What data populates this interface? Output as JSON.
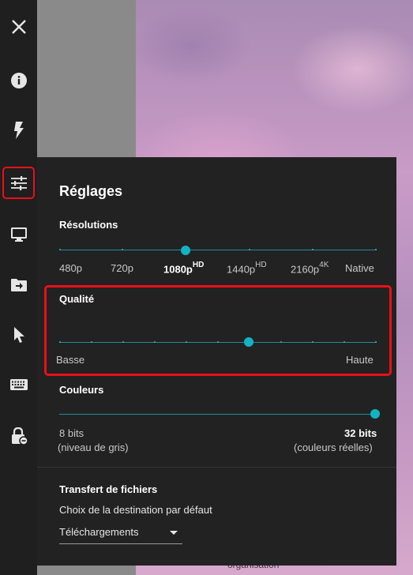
{
  "background": {
    "caption": "organisation"
  },
  "rail": {
    "items": [
      {
        "icon": "close-icon"
      },
      {
        "icon": "info-icon"
      },
      {
        "icon": "lightning-icon"
      },
      {
        "icon": "sliders-icon",
        "active": true
      },
      {
        "icon": "monitor-icon"
      },
      {
        "icon": "folder-arrow-icon"
      },
      {
        "icon": "cursor-icon"
      },
      {
        "icon": "keyboard-icon"
      },
      {
        "icon": "lock-icon"
      }
    ],
    "active_border_color": "#e8101a"
  },
  "settings": {
    "title": "Réglages",
    "resolutions": {
      "title": "Résolutions",
      "labels": [
        {
          "text": "480p",
          "sup": ""
        },
        {
          "text": "720p",
          "sup": ""
        },
        {
          "text": "1080p",
          "sup": "HD"
        },
        {
          "text": "1440p",
          "sup": "HD"
        },
        {
          "text": "2160p",
          "sup": "4K"
        },
        {
          "text": "Native",
          "sup": ""
        }
      ],
      "selected_index": 2
    },
    "quality": {
      "title": "Qualité",
      "min_label": "Basse",
      "max_label": "Haute",
      "steps": 10,
      "value_step": 6
    },
    "colors": {
      "title": "Couleurs",
      "min_label": "8 bits",
      "min_sub": "(niveau de gris)",
      "max_label": "32 bits",
      "max_sub": "(couleurs réelles)",
      "value": 1.0
    },
    "file_transfer": {
      "title": "Transfert de fichiers",
      "description": "Choix de la destination par défaut",
      "destination": "Téléchargements"
    },
    "accent_color": "#11b3c4"
  }
}
